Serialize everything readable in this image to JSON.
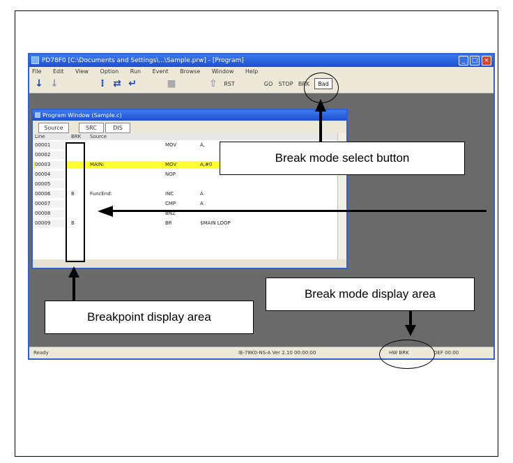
{
  "app": {
    "title": "PD78F0 [C:\\Documents and Settings\\...\\Sample.prw] - [Program]",
    "menu": [
      "File",
      "Edit",
      "View",
      "Option",
      "Run",
      "Event",
      "Browse",
      "Window",
      "Help"
    ],
    "toolbar": {
      "text_buttons": [
        "RST",
        "GO",
        "STOP",
        "BRK"
      ],
      "break_mode_button": "Bad"
    }
  },
  "program_window": {
    "title": "Program Window (Sample.c)",
    "tabs": [
      "Source",
      "SRC",
      "DIS"
    ],
    "header": [
      "Line",
      "BRK",
      "Source"
    ],
    "rows": [
      {
        "line": "00001",
        "brk": "",
        "label": "",
        "mnemonic": "MOV",
        "operand": "A,",
        "highlight": false
      },
      {
        "line": "00002",
        "brk": "",
        "label": "",
        "mnemonic": "",
        "operand": "",
        "highlight": false
      },
      {
        "line": "00003",
        "brk": "",
        "label": "MAIN:",
        "mnemonic": "MOV",
        "operand": "A,#0",
        "highlight": true
      },
      {
        "line": "00004",
        "brk": "",
        "label": "",
        "mnemonic": "NOP",
        "operand": "",
        "highlight": false
      },
      {
        "line": "00005",
        "brk": "",
        "label": "",
        "mnemonic": "",
        "operand": "",
        "highlight": false
      },
      {
        "line": "00006",
        "brk": "B",
        "label": "FuncEnd:",
        "mnemonic": "INC",
        "operand": "A",
        "highlight": false
      },
      {
        "line": "00007",
        "brk": "",
        "label": "",
        "mnemonic": "CMP",
        "operand": "A",
        "highlight": false
      },
      {
        "line": "00008",
        "brk": "",
        "label": "",
        "mnemonic": "BNZ",
        "operand": "",
        "highlight": false
      },
      {
        "line": "00009",
        "brk": "B",
        "label": "",
        "mnemonic": "BR",
        "operand": "$MAIN LOOP",
        "highlight": false
      }
    ]
  },
  "status_bar": {
    "left": "Ready",
    "middle": "IE-78K0-NS-A  Ver 2.10  00:00:00",
    "break_mode": "HW BRK",
    "right": "DEF  00:00"
  },
  "callouts": {
    "break_mode_select": "Break mode select  button",
    "break_mode_display": "Break mode display area",
    "breakpoint_display": "Breakpoint display area"
  }
}
